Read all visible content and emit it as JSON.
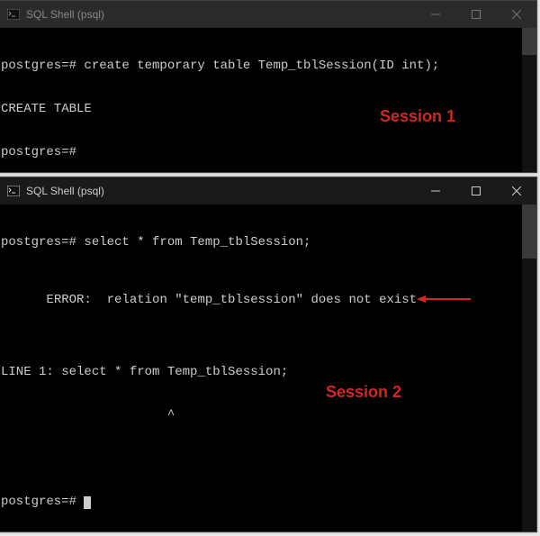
{
  "window1": {
    "title": "SQL Shell (psql)",
    "lines": {
      "l0": "postgres=# create temporary table Temp_tblSession(ID int);",
      "l1": "CREATE TABLE",
      "l2": "postgres=#"
    },
    "session_label": "Session 1"
  },
  "window2": {
    "title": "SQL Shell (psql)",
    "lines": {
      "l0": "postgres=# select * from Temp_tblSession;",
      "l1": "ERROR:  relation \"temp_tblsession\" does not exist",
      "l2": "LINE 1: select * from Temp_tblSession;",
      "l3": "                      ^",
      "l4": "postgres=#"
    },
    "session_label": "Session 2"
  }
}
